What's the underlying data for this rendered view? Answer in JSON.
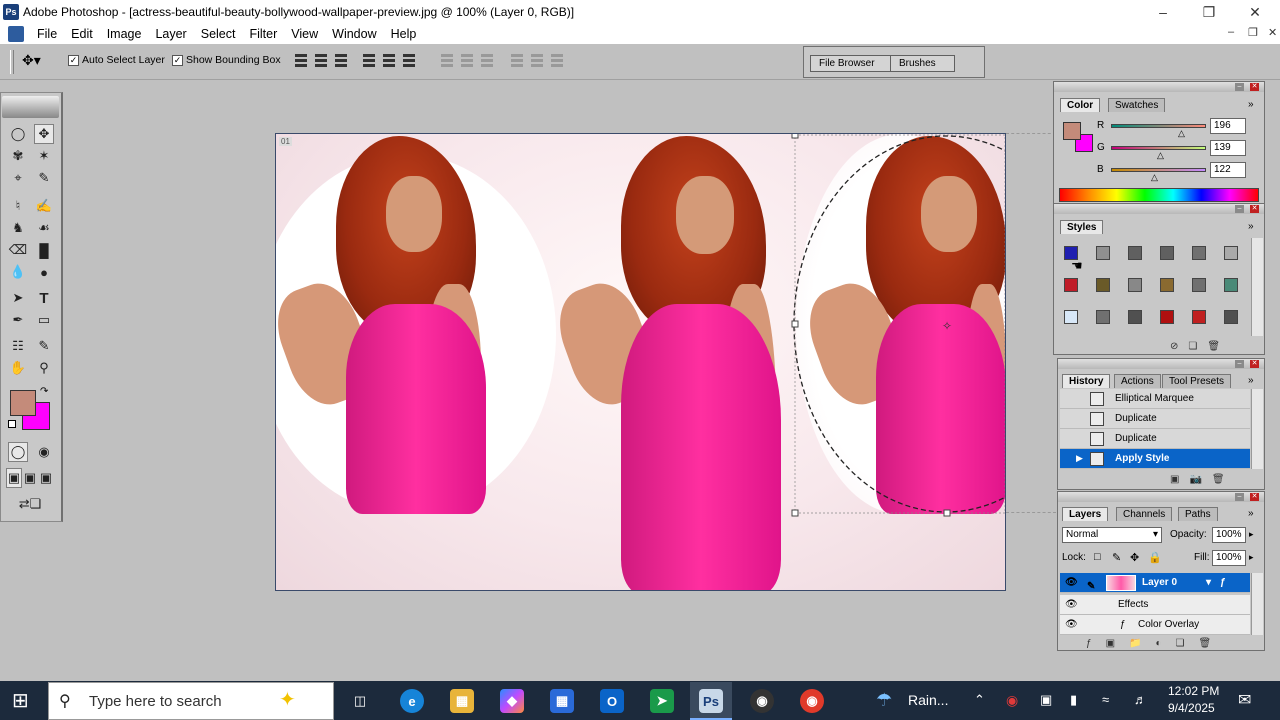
{
  "window": {
    "title": "Adobe Photoshop - [actress-beautiful-beauty-bollywood-wallpaper-preview.jpg @ 100% (Layer 0, RGB)]",
    "icon_name": "photoshop-app-icon"
  },
  "menu": [
    "File",
    "Edit",
    "Image",
    "Layer",
    "Select",
    "Filter",
    "View",
    "Window",
    "Help"
  ],
  "options_bar": {
    "auto_select_layer": "Auto Select Layer",
    "show_bounding_box": "Show Bounding Box",
    "file_browser": "File Browser",
    "brushes": "Brushes"
  },
  "canvas": {
    "doc_badge": "01"
  },
  "color_panel": {
    "tabs": [
      "Color",
      "Swatches"
    ],
    "active_tab": "Color",
    "fg_color": "#c48b7a",
    "bg_color": "#ff00ff",
    "r_label": "R",
    "g_label": "G",
    "b_label": "B",
    "r": "196",
    "g": "139",
    "b": "122"
  },
  "styles_panel": {
    "title": "Styles",
    "swatches": [
      "#2020b0",
      "#909090",
      "#606060",
      "#606060",
      "#707070",
      "#aaaaaa",
      "#c01c28",
      "#6a5a28",
      "#888888",
      "#8a6a30",
      "#707070",
      "#4a8a78",
      "#d8e8f8",
      "#707070",
      "#505050",
      "#b01010",
      "#c02020",
      "#505050"
    ]
  },
  "history_panel": {
    "tabs": [
      "History",
      "Actions",
      "Tool Presets"
    ],
    "active_tab": "History",
    "items": [
      {
        "label": "Elliptical Marquee",
        "selected": false
      },
      {
        "label": "Duplicate",
        "selected": false
      },
      {
        "label": "Duplicate",
        "selected": false
      },
      {
        "label": "Apply Style",
        "selected": true
      }
    ]
  },
  "layers_panel": {
    "tabs": [
      "Layers",
      "Channels",
      "Paths"
    ],
    "active_tab": "Layers",
    "blend_mode": "Normal",
    "opacity_label": "Opacity:",
    "opacity": "100%",
    "lock_label": "Lock:",
    "fill_label": "Fill:",
    "fill": "100%",
    "layers": [
      {
        "name": "Layer 0",
        "selected": true
      },
      {
        "name": "Effects",
        "selected": false
      },
      {
        "name": "Color Overlay",
        "selected": false
      }
    ]
  },
  "taskbar": {
    "search_placeholder": "Type here to search",
    "weather": "Rain...",
    "time": "12:02 PM",
    "date": "9/4/2025",
    "start_label": "⊞"
  }
}
